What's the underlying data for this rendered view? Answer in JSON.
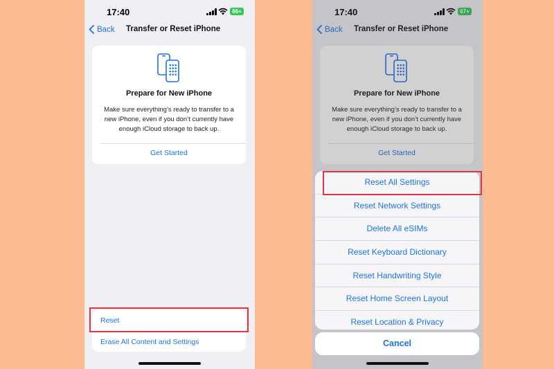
{
  "left_screen": {
    "status_bar": {
      "time": "17:40",
      "battery": "66+",
      "battery_color": "#34c759"
    },
    "nav": {
      "back_label": "Back",
      "title": "Transfer or Reset iPhone"
    },
    "prepare_card": {
      "title": "Prepare for New iPhone",
      "body": "Make sure everything’s ready to transfer to a new iPhone, even if you don’t currently have enough iCloud storage to back up.",
      "action": "Get Started",
      "icon": "two-phones-icon"
    },
    "reset_group": {
      "reset_label": "Reset",
      "erase_label": "Erase All Content and Settings"
    },
    "highlight_color": "#e6323c"
  },
  "right_screen": {
    "status_bar": {
      "time": "17:40",
      "battery": "67+",
      "battery_color": "#34c759"
    },
    "nav": {
      "back_label": "Back",
      "title": "Transfer or Reset iPhone"
    },
    "prepare_card": {
      "title": "Prepare for New iPhone",
      "body": "Make sure everything’s ready to transfer to a new iPhone, even if you don’t currently have enough iCloud storage to back up.",
      "action": "Get Started",
      "icon": "two-phones-icon"
    },
    "reset_sheet": {
      "items": [
        "Reset All Settings",
        "Reset Network Settings",
        "Delete All eSIMs",
        "Reset Keyboard Dictionary",
        "Reset Handwriting Style",
        "Reset Home Screen Layout",
        "Reset Location & Privacy"
      ],
      "cancel_label": "Cancel"
    }
  },
  "colors": {
    "background": "#fcbb93",
    "accent": "#1a73e8",
    "highlight": "#e6323c"
  }
}
